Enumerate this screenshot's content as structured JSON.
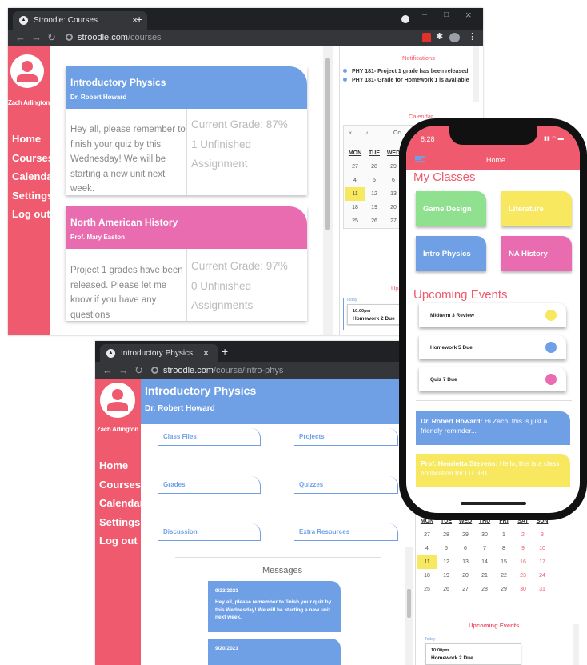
{
  "courses_window": {
    "tab_title": "Stroodle: Courses",
    "url_domain": "stroodle.com",
    "url_path": "/courses",
    "user_name": "Zach Arlington",
    "nav": [
      "Home",
      "Courses",
      "Calendar",
      "Settings",
      "Log out"
    ],
    "cards": [
      {
        "title": "Introductory Physics",
        "professor": "Dr. Robert Howard",
        "message": "Hey all, please remember to finish your quiz by this Wednesday! We will be starting a new unit next week.",
        "grade": "Current Grade: 87%",
        "unfinished": "1 Unfinished Assignment",
        "color": "#6fa0e6"
      },
      {
        "title": "North American History",
        "professor": "Prof. Mary Easton",
        "message": "Project 1 grades have been released. Please let me know if you have any questions",
        "grade": "Current Grade: 97%",
        "unfinished": "0 Unfinished Assignments",
        "color": "#e96bb0"
      }
    ],
    "notifications_title": "Notifications",
    "notifications": [
      "PHY 181- Project 1 grade has been released",
      "PHY 181- Grade for Homework 1 is available"
    ],
    "calendar_title": "Calendar",
    "cal_days": [
      "MON",
      "TUE",
      "WED"
    ],
    "cal_rows": [
      [
        "27",
        "28",
        "29"
      ],
      [
        "4",
        "5",
        "6"
      ],
      [
        "11",
        "12",
        "13"
      ],
      [
        "18",
        "19",
        "20"
      ],
      [
        "25",
        "26",
        "27"
      ]
    ],
    "cal_month_partial": "Oc",
    "upcoming_partial": "Up",
    "event_day": "Today",
    "event_time": "10:00pm",
    "event_name": "Homework 2 Due"
  },
  "course_window": {
    "tab_title": "Introductory Physics",
    "url_domain": "stroodle.com",
    "url_path": "/course/intro-phys",
    "user_name": "Zach Arlington",
    "nav": [
      "Home",
      "Courses",
      "Calendar",
      "Settings",
      "Log out"
    ],
    "course_title": "Introductory Physics",
    "professor": "Dr. Robert Howard",
    "links": [
      "Class Files",
      "Projects",
      "Grades",
      "Quizzes",
      "Discussion",
      "Extra Resources"
    ],
    "messages_title": "Messages",
    "messages": [
      {
        "date": "9/23/2021",
        "text": "Hey all, please remember to finish your quiz by this Wednesday! We will be starting a new unit next week."
      },
      {
        "date": "9/20/2021",
        "text": ""
      }
    ],
    "cal_days": [
      "MON",
      "TUE",
      "WED",
      "THU",
      "FRI",
      "SAT",
      "SUN"
    ],
    "cal_rows": [
      [
        "27",
        "28",
        "29",
        "30",
        "1",
        "2",
        "3"
      ],
      [
        "4",
        "5",
        "6",
        "7",
        "8",
        "9",
        "10"
      ],
      [
        "11",
        "12",
        "13",
        "14",
        "15",
        "16",
        "17"
      ],
      [
        "18",
        "19",
        "20",
        "21",
        "22",
        "23",
        "24"
      ],
      [
        "25",
        "26",
        "27",
        "28",
        "29",
        "30",
        "31"
      ]
    ],
    "upcoming_title": "Upcoming Events",
    "event_day": "Today",
    "event_time": "10:00pm",
    "event_name": "Homework 2 Due"
  },
  "phone": {
    "time": "8:28",
    "title": "Home",
    "classes_title": "My Classes",
    "classes": [
      {
        "name": "Game Design",
        "color": "#8fe08f"
      },
      {
        "name": "Literature",
        "color": "#f7e860"
      },
      {
        "name": "Intro Physics",
        "color": "#6fa0e6"
      },
      {
        "name": "NA History",
        "color": "#e96bb0"
      }
    ],
    "events_title": "Upcoming Events",
    "events": [
      {
        "name": "Midterm 3 Review",
        "color": "#f7e860"
      },
      {
        "name": "Homework 5 Due",
        "color": "#6fa0e6"
      },
      {
        "name": "Quiz 7 Due",
        "color": "#e96bb0"
      }
    ],
    "messages": [
      {
        "from": "Dr. Robert Howard:",
        "text": " Hi Zach, this is just a friendly reminder...",
        "color": "#6fa0e6"
      },
      {
        "from": "Prof. Henrietta Stevens:",
        "text": " Hello, this is a class notification for LIT 331...",
        "color": "#f7e860"
      }
    ]
  }
}
